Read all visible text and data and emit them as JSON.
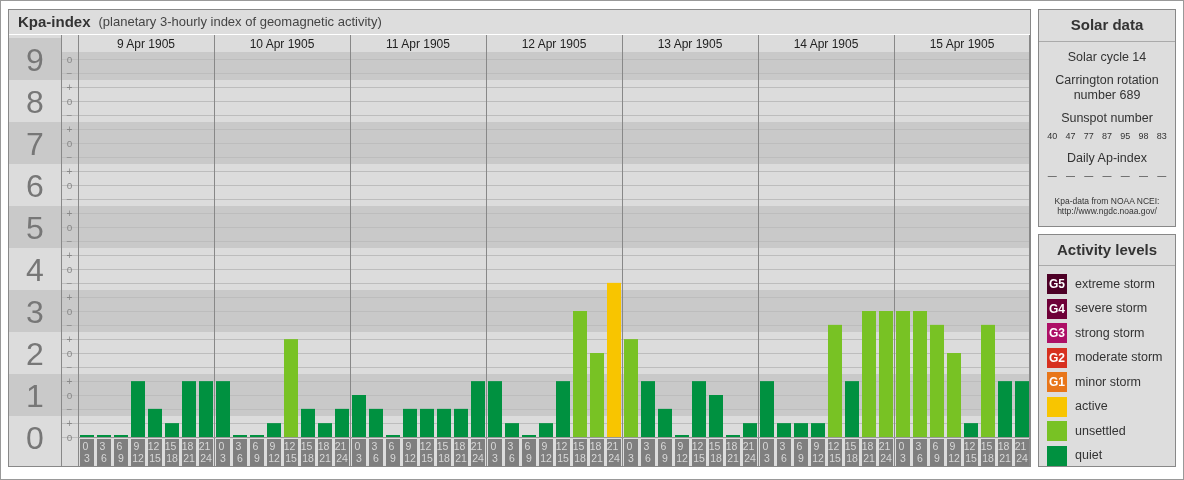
{
  "header": {
    "title": "Kpa-index",
    "subtitle": "(planetary 3-hourly index of geomagnetic activity)"
  },
  "chart": {
    "days": [
      "9 Apr 1905",
      "10 Apr 1905",
      "11 Apr 1905",
      "12 Apr 1905",
      "13 Apr 1905",
      "14 Apr 1905",
      "15 Apr 1905"
    ],
    "y_sub_ticks": [
      "o",
      "−",
      "+",
      "o",
      "−",
      "+",
      "o",
      "−",
      "+",
      "o",
      "−",
      "+",
      "o",
      "−",
      "+",
      "o",
      "−",
      "+",
      "o",
      "−",
      "+",
      "o",
      "−",
      "+",
      "o",
      "−",
      "+",
      "o"
    ],
    "chart_data": {
      "type": "bar",
      "stacked": true,
      "grid": true,
      "ylim": [
        0,
        9
      ],
      "yticks": [
        0,
        1,
        2,
        3,
        4,
        5,
        6,
        7,
        8,
        9
      ],
      "categories": [
        "0 3",
        "3 6",
        "6 9",
        "9 12",
        "12 15",
        "15 18",
        "18 21",
        "21 24",
        "0 3",
        "3 6",
        "6 9",
        "9 12",
        "12 15",
        "15 18",
        "18 21",
        "21 24",
        "0 3",
        "3 6",
        "6 9",
        "9 12",
        "12 15",
        "15 18",
        "18 21",
        "21 24",
        "0 3",
        "3 6",
        "6 9",
        "9 12",
        "12 15",
        "15 18",
        "18 21",
        "21 24",
        "0 3",
        "3 6",
        "6 9",
        "9 12",
        "12 15",
        "15 18",
        "18 21",
        "21 24",
        "0 3",
        "3 6",
        "6 9",
        "9 12",
        "12 15",
        "15 18",
        "18 21",
        "21 24",
        "0 3",
        "3 6",
        "6 9",
        "9 12",
        "12 15",
        "15 18",
        "18 21",
        "21 24"
      ],
      "series": [
        {
          "color": "#009140",
          "values": [
            0,
            0,
            0,
            1.33,
            0.67,
            0.33,
            1.33,
            1.33,
            1.33,
            0,
            0,
            0.33,
            null,
            0.67,
            0.33,
            0.67,
            1,
            0.67,
            0,
            0.67,
            0.67,
            0.67,
            0.67,
            1.33,
            1.33,
            0.33,
            0,
            0.33,
            1.33,
            null,
            null,
            null,
            null,
            1.33,
            0.67,
            0,
            1.33,
            1,
            0,
            0.33,
            1.33,
            0.33,
            0.33,
            0.33,
            null,
            1.33,
            null,
            null,
            null,
            null,
            null,
            null,
            0.33,
            null,
            1.33,
            1.33
          ]
        },
        {
          "color": "#78c224",
          "values": [
            null,
            null,
            null,
            null,
            null,
            null,
            null,
            null,
            null,
            null,
            null,
            null,
            2.33,
            null,
            null,
            null,
            null,
            null,
            null,
            null,
            null,
            null,
            null,
            null,
            null,
            null,
            null,
            null,
            null,
            3,
            2,
            null,
            2.33,
            null,
            null,
            null,
            null,
            null,
            null,
            null,
            null,
            null,
            null,
            null,
            2.67,
            null,
            3,
            3,
            3,
            3,
            2.67,
            2,
            null,
            2.67,
            null,
            null
          ]
        },
        {
          "color": "#f8c500",
          "values": [
            null,
            null,
            null,
            null,
            null,
            null,
            null,
            null,
            null,
            null,
            null,
            null,
            null,
            null,
            null,
            null,
            null,
            null,
            null,
            null,
            null,
            null,
            null,
            null,
            null,
            null,
            null,
            null,
            null,
            null,
            null,
            3.67,
            null,
            null,
            null,
            null,
            null,
            null,
            null,
            null,
            null,
            null,
            null,
            null,
            null,
            null,
            null,
            null,
            null,
            null,
            null,
            null,
            null,
            null,
            null,
            null
          ]
        }
      ]
    }
  },
  "solar_data": {
    "title": "Solar data",
    "solar_cycle": "Solar cycle 14",
    "carrington": "Carrington rotation number 689",
    "sunspot_label": "Sunspot number",
    "sunspots": [
      "40",
      "47",
      "77",
      "87",
      "95",
      "98",
      "83"
    ],
    "ap_label": "Daily Ap-index",
    "ap_values": [
      "—",
      "—",
      "—",
      "—",
      "—",
      "—",
      "—"
    ],
    "source": "Kpa-data from NOAA NCEI:",
    "source_url": "http://www.ngdc.noaa.gov/"
  },
  "activity_levels": {
    "title": "Activity levels",
    "items": [
      {
        "badge": "G5",
        "label": "extreme storm",
        "color": "#4d0026"
      },
      {
        "badge": "G4",
        "label": "severe storm",
        "color": "#6e0038"
      },
      {
        "badge": "G3",
        "label": "strong storm",
        "color": "#ad0f66"
      },
      {
        "badge": "G2",
        "label": "moderate storm",
        "color": "#d7301f"
      },
      {
        "badge": "G1",
        "label": "minor storm",
        "color": "#e8761a"
      },
      {
        "label": "active",
        "color": "#f8c500"
      },
      {
        "label": "unsettled",
        "color": "#78c224"
      },
      {
        "label": "quiet",
        "color": "#009140"
      }
    ]
  }
}
